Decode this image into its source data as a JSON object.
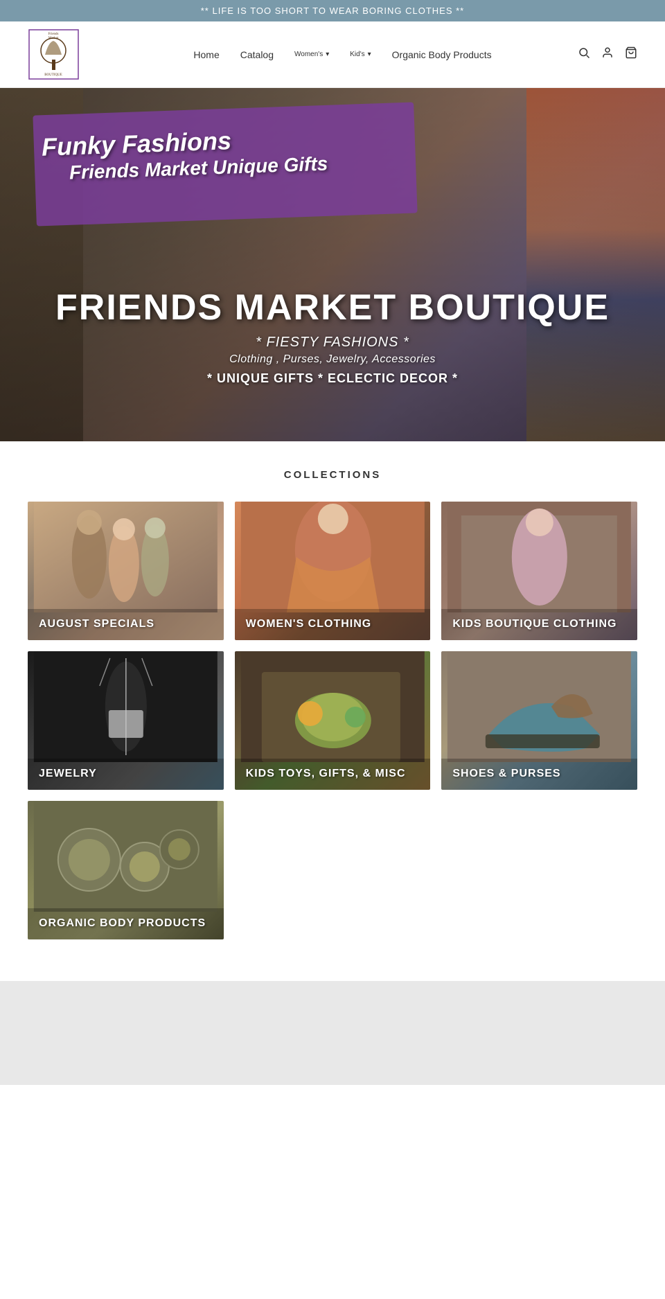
{
  "announcement": {
    "text": "** LIFE IS TOO SHORT TO WEAR BORING CLOTHES **"
  },
  "header": {
    "logo_alt": "Friends Market Boutique",
    "nav": {
      "home": "Home",
      "catalog": "Catalog",
      "womens": "Women's",
      "kids": "Kid's",
      "organic": "Organic Body Products"
    }
  },
  "hero": {
    "banner_text1": "Funky Fashions",
    "banner_text2": "Friends Market   Unique Gifts",
    "title": "FRIENDS MARKET BOUTIQUE",
    "subtitle1": "* FIESTY FASHIONS *",
    "subtitle2": "Clothing , Purses, Jewelry, Accessories",
    "subtitle3": "* UNIQUE GIFTS * ECLECTIC DECOR *"
  },
  "collections": {
    "heading": "COLLECTIONS",
    "items": [
      {
        "id": "august-specials",
        "label": "AUGUST SPECIALS",
        "bg_class": "bg-august"
      },
      {
        "id": "womens-clothing",
        "label": "WOMEN'S CLOTHING",
        "bg_class": "bg-womens"
      },
      {
        "id": "kids-boutique-clothing",
        "label": "KIDS BOUTIQUE CLOTHING",
        "bg_class": "bg-kids-clothing"
      },
      {
        "id": "jewelry",
        "label": "JEWELRY",
        "bg_class": "bg-jewelry"
      },
      {
        "id": "kids-toys-gifts-misc",
        "label": "KIDS TOYS, GIFTS, & MISC",
        "bg_class": "bg-kids-toys"
      },
      {
        "id": "shoes-purses",
        "label": "SHOES & PURSES",
        "bg_class": "bg-shoes"
      },
      {
        "id": "organic-body-products",
        "label": "ORGANIC BODY PRODUCTS",
        "bg_class": "bg-organic"
      }
    ]
  }
}
